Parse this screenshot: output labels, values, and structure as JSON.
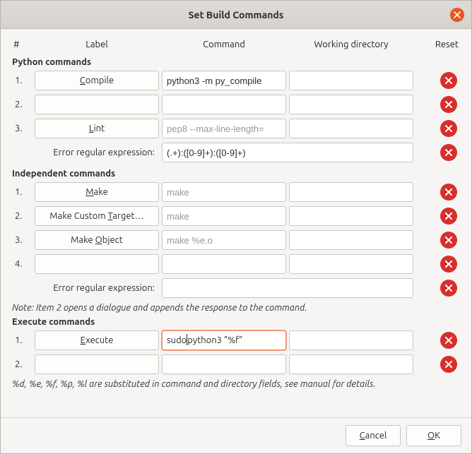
{
  "title": "Set Build Commands",
  "headers": {
    "num": "#",
    "label": "Label",
    "command": "Command",
    "wd": "Working directory",
    "reset": "Reset"
  },
  "sections": {
    "python": {
      "title": "Python commands",
      "rows": [
        {
          "n": "1.",
          "label": "Compile",
          "mn": "C",
          "cmd": "python3 -m py_compile",
          "ph": "",
          "wd": ""
        },
        {
          "n": "2.",
          "label": "",
          "mn": "",
          "cmd": "",
          "ph": "",
          "wd": ""
        },
        {
          "n": "3.",
          "label": "Lint",
          "mn": "L",
          "cmd": "",
          "ph": "pep8 --max-line-length=",
          "wd": ""
        }
      ],
      "regex_label": "Error regular expression:",
      "regex_value": "(.+):([0-9]+):([0-9]+)"
    },
    "independent": {
      "title": "Independent commands",
      "rows": [
        {
          "n": "1.",
          "label": "Make",
          "mn": "M",
          "cmd": "",
          "ph": "make",
          "wd": ""
        },
        {
          "n": "2.",
          "label": "Make Custom Target…",
          "mn": "T",
          "cmd": "",
          "ph": "make",
          "wd": ""
        },
        {
          "n": "3.",
          "label": "Make Object",
          "mn": "O",
          "cmd": "",
          "ph": "make %e.o",
          "wd": ""
        },
        {
          "n": "4.",
          "label": "",
          "mn": "",
          "cmd": "",
          "ph": "",
          "wd": ""
        }
      ],
      "regex_label": "Error regular expression:",
      "regex_value": "",
      "note": "Note: Item 2 opens a dialogue and appends the response to the command."
    },
    "execute": {
      "title": "Execute commands",
      "rows": [
        {
          "n": "1.",
          "label": "Execute",
          "mn": "E",
          "cmd_pre": "sudo",
          "cmd_post": " python3 \"%f\"",
          "wd": ""
        },
        {
          "n": "2.",
          "label": "",
          "mn": "",
          "cmd": "",
          "wd": ""
        }
      ]
    }
  },
  "substitution_note": "%d, %e, %f, %p, %l are substituted in command and directory fields, see manual for details.",
  "buttons": {
    "cancel": "Cancel",
    "ok": "OK"
  }
}
